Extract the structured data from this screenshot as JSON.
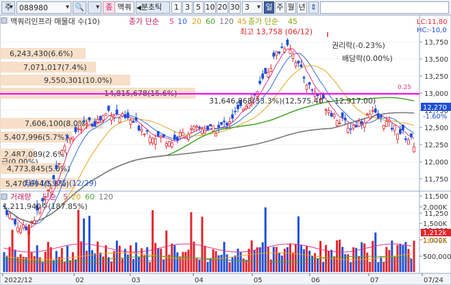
{
  "toolbar": {
    "type_label": "주",
    "code_value": "088980",
    "search_icon": "search-icon",
    "stock_badge": "종",
    "stock_name": "맥쿼",
    "period_label": "분초틱",
    "intervals": [
      "1",
      "3",
      "5",
      "10",
      "20",
      "30"
    ],
    "interval_input": "3",
    "period_day": "일",
    "period_week": "주",
    "period_month": "월",
    "period_year": "년",
    "updown_icon": "updown-arrow-icon"
  },
  "price_panel": {
    "title": "맥쿼리인프라 매물대 수(10)",
    "ma_legend_prefix": "종가 단순",
    "ma_values": [
      "5",
      "10",
      "20",
      "60",
      "120",
      "45"
    ],
    "ma_extra_prefix": "종가 단순",
    "ma_extra_value": "45",
    "lc_label": "LC:11,80",
    "hc_label": "HC:-10,0",
    "high_marker": "최고 13,758 (06/12)",
    "low_marker": "최저 10,975 (12/29)",
    "rights_marker": "권리락(-0.23%)",
    "dividend_marker": "배당락(0.00%)",
    "range_marker": "31,646,868(33.3%)(12,575.40 ~ 12,917.00)",
    "current_price": "12,270",
    "current_change": "-1.60%",
    "small_marker": "0.25",
    "volume_profile_labels": [
      "6,243,430(6.6%)",
      "7,071,017(7.4%)",
      "9,550,301(10.0%)",
      "14,815,678(15.6%)",
      "7,606,100(8.0%)",
      "5,407,996(5.7%)",
      "2,487,089(2.6%)",
      "급(0.00%)",
      "4,773,845(5.0%)",
      "5,470,694(5.8%)"
    ],
    "y_ticks": [
      "13,750",
      "13,500",
      "13,250",
      "13,000",
      "12,750",
      "12,500",
      "12,250",
      "12,000",
      "11,750",
      "11,500",
      "11,250",
      "11,000"
    ]
  },
  "volume_panel": {
    "title": "거래량",
    "ma_prefix": "단순",
    "ma_values": [
      "5",
      "20",
      "60",
      "120"
    ],
    "current_volume": "1,211,940주(187.85%)",
    "current_badge": "1,212k",
    "ratio_badge": "187.85",
    "y_ticks": [
      "2,000K",
      "1,500K",
      "1,000K",
      "500,000"
    ]
  },
  "x_axis": {
    "labels": [
      "2022/12",
      "02",
      "03",
      "04",
      "05",
      "06",
      "07",
      "07/24"
    ]
  },
  "colors": {
    "up": "#e3242b",
    "down": "#1f4fd8",
    "ma5": "#e0348a",
    "ma10": "#2f6fd8",
    "ma20": "#e8a21a",
    "ma60": "#4aa72f",
    "ma120": "#7a7a7a",
    "ma45": "#8aa600",
    "guide_line": "#ff00ff",
    "profile_fill": "#f6d9bf"
  },
  "chart_data": {
    "type": "candlestick",
    "y_range": [
      10900,
      13900
    ],
    "price_sample": [
      11350,
      11100,
      11000,
      11200,
      11500,
      11900,
      12350,
      12450,
      12550,
      12600,
      12750,
      12650,
      12600,
      12500,
      12400,
      12350,
      12300,
      12400,
      12450,
      12500,
      12450,
      12550,
      12700,
      12850,
      13000,
      13300,
      13600,
      13750,
      13400,
      13100,
      12950,
      12750,
      12600,
      12500,
      12600,
      12700,
      12600,
      12500,
      12400,
      12270
    ]
  }
}
